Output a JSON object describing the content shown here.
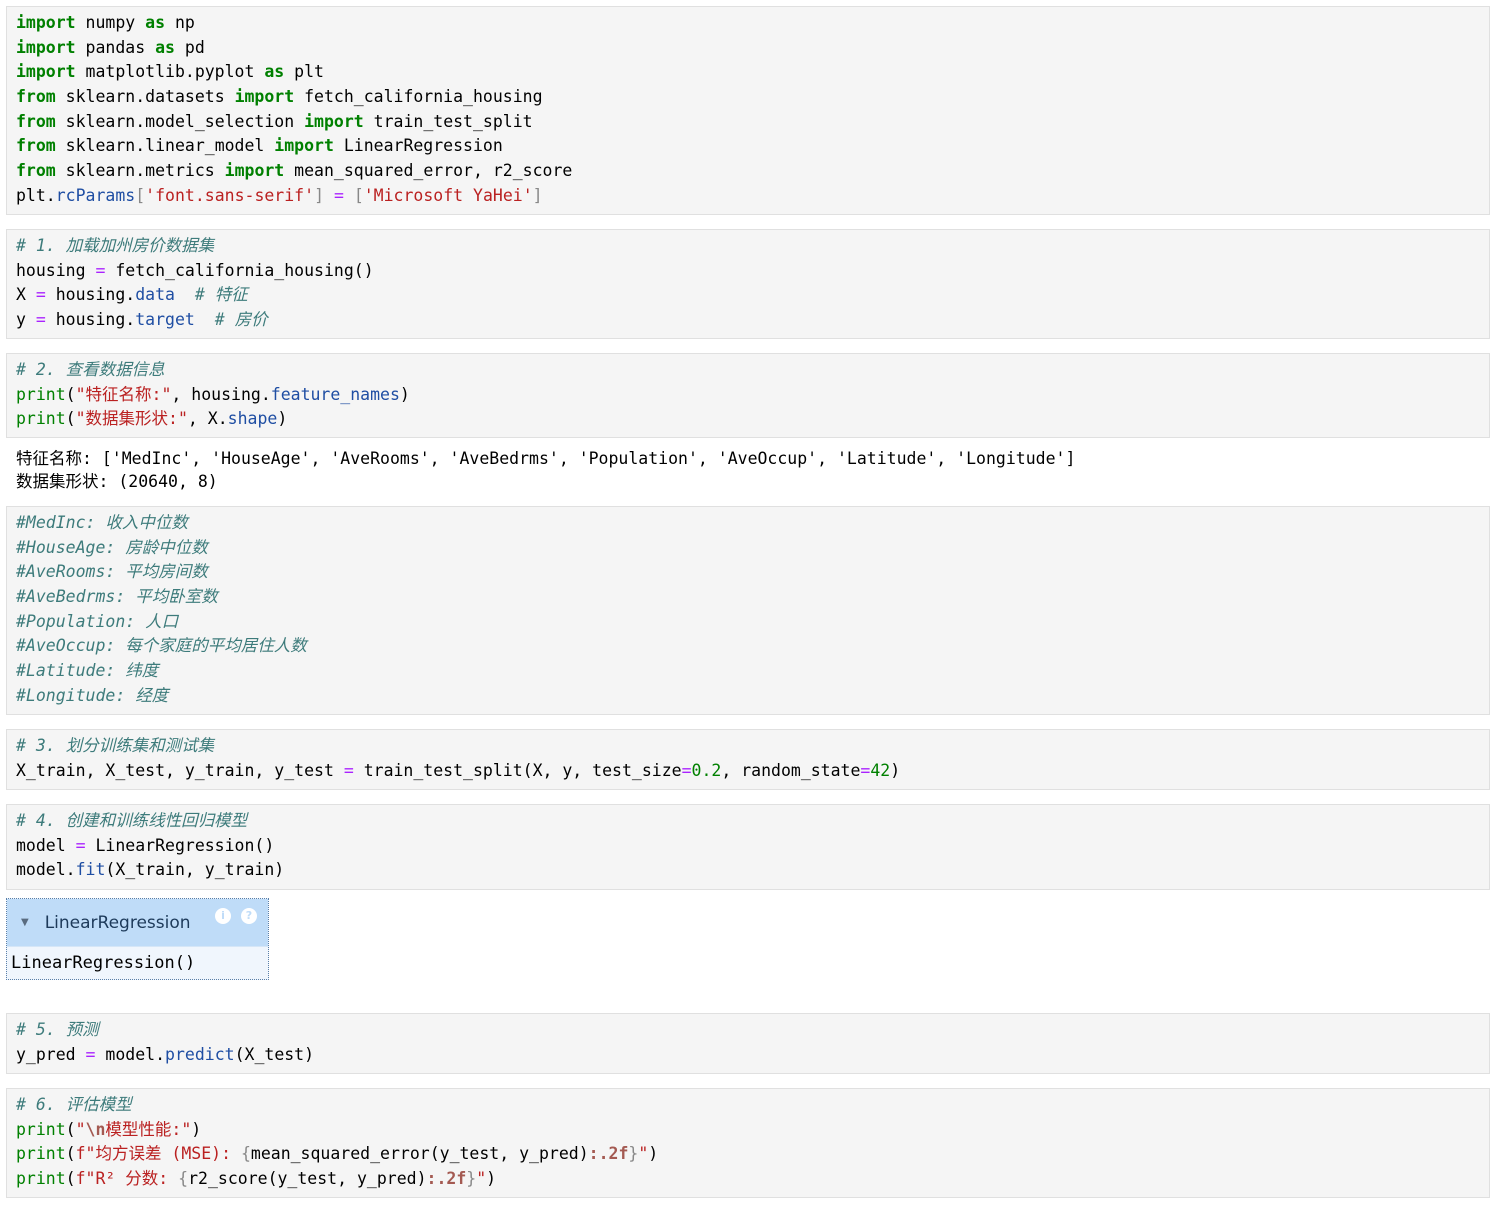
{
  "cells": [
    {
      "id": "imports",
      "lines": [
        [
          [
            "kw",
            "import"
          ],
          [
            "t",
            " numpy "
          ],
          [
            "kw",
            "as"
          ],
          [
            "t",
            " np"
          ]
        ],
        [
          [
            "kw",
            "import"
          ],
          [
            "t",
            " pandas "
          ],
          [
            "kw",
            "as"
          ],
          [
            "t",
            " pd"
          ]
        ],
        [
          [
            "kw",
            "import"
          ],
          [
            "t",
            " matplotlib.pyplot "
          ],
          [
            "kw",
            "as"
          ],
          [
            "t",
            " plt"
          ]
        ],
        [
          [
            "kw",
            "from"
          ],
          [
            "t",
            " sklearn.datasets "
          ],
          [
            "kw",
            "import"
          ],
          [
            "t",
            " fetch_california_housing"
          ]
        ],
        [
          [
            "kw",
            "from"
          ],
          [
            "t",
            " sklearn.model_selection "
          ],
          [
            "kw",
            "import"
          ],
          [
            "t",
            " train_test_split"
          ]
        ],
        [
          [
            "kw",
            "from"
          ],
          [
            "t",
            " sklearn.linear_model "
          ],
          [
            "kw",
            "import"
          ],
          [
            "t",
            " LinearRegression"
          ]
        ],
        [
          [
            "kw",
            "from"
          ],
          [
            "t",
            " sklearn.metrics "
          ],
          [
            "kw",
            "import"
          ],
          [
            "t",
            " mean_squared_error, r2_score"
          ]
        ],
        [
          [
            "t",
            "plt."
          ],
          [
            "attr",
            "rcParams"
          ],
          [
            "brk",
            "["
          ],
          [
            "str",
            "'font.sans-serif'"
          ],
          [
            "brk",
            "]"
          ],
          [
            "t",
            " "
          ],
          [
            "op",
            "="
          ],
          [
            "t",
            " "
          ],
          [
            "brk",
            "["
          ],
          [
            "str",
            "'Microsoft YaHei'"
          ],
          [
            "brk",
            "]"
          ]
        ]
      ]
    },
    {
      "id": "load-data",
      "lines": [
        [
          [
            "cm",
            "# 1. 加载加州房价数据集"
          ]
        ],
        [
          [
            "t",
            "housing "
          ],
          [
            "op",
            "="
          ],
          [
            "t",
            " fetch_california_housing()"
          ]
        ],
        [
          [
            "t",
            "X "
          ],
          [
            "op",
            "="
          ],
          [
            "t",
            " housing."
          ],
          [
            "attr",
            "data"
          ],
          [
            "t",
            "  "
          ],
          [
            "cm",
            "# 特征"
          ]
        ],
        [
          [
            "t",
            "y "
          ],
          [
            "op",
            "="
          ],
          [
            "t",
            " housing."
          ],
          [
            "attr",
            "target"
          ],
          [
            "t",
            "  "
          ],
          [
            "cm",
            "# 房价"
          ]
        ]
      ]
    },
    {
      "id": "inspect-data",
      "lines": [
        [
          [
            "cm",
            "# 2. 查看数据信息"
          ]
        ],
        [
          [
            "fn",
            "print"
          ],
          [
            "t",
            "("
          ],
          [
            "str",
            "\"特征名称:\""
          ],
          [
            "t",
            ", housing."
          ],
          [
            "attr",
            "feature_names"
          ],
          [
            "t",
            ")"
          ]
        ],
        [
          [
            "fn",
            "print"
          ],
          [
            "t",
            "("
          ],
          [
            "str",
            "\"数据集形状:\""
          ],
          [
            "t",
            ", X."
          ],
          [
            "attr",
            "shape"
          ],
          [
            "t",
            ")"
          ]
        ]
      ]
    },
    {
      "id": "feature-notes",
      "lines": [
        [
          [
            "cm",
            "#MedInc: 收入中位数"
          ]
        ],
        [
          [
            "cm",
            "#HouseAge: 房龄中位数"
          ]
        ],
        [
          [
            "cm",
            "#AveRooms: 平均房间数"
          ]
        ],
        [
          [
            "cm",
            "#AveBedrms: 平均卧室数"
          ]
        ],
        [
          [
            "cm",
            "#Population: 人口"
          ]
        ],
        [
          [
            "cm",
            "#AveOccup: 每个家庭的平均居住人数"
          ]
        ],
        [
          [
            "cm",
            "#Latitude: 纬度"
          ]
        ],
        [
          [
            "cm",
            "#Longitude: 经度"
          ]
        ]
      ]
    },
    {
      "id": "split",
      "lines": [
        [
          [
            "cm",
            "# 3. 划分训练集和测试集"
          ]
        ],
        [
          [
            "t",
            "X_train, X_test, y_train, y_test "
          ],
          [
            "op",
            "="
          ],
          [
            "t",
            " train_test_split(X, y, test_size"
          ],
          [
            "op",
            "="
          ],
          [
            "num",
            "0.2"
          ],
          [
            "t",
            ", random_state"
          ],
          [
            "op",
            "="
          ],
          [
            "num",
            "42"
          ],
          [
            "t",
            ")"
          ]
        ]
      ]
    },
    {
      "id": "train",
      "lines": [
        [
          [
            "cm",
            "# 4. 创建和训练线性回归模型"
          ]
        ],
        [
          [
            "t",
            "model "
          ],
          [
            "op",
            "="
          ],
          [
            "t",
            " LinearRegression()"
          ]
        ],
        [
          [
            "t",
            "model."
          ],
          [
            "attr",
            "fit"
          ],
          [
            "t",
            "(X_train, y_train)"
          ]
        ]
      ]
    },
    {
      "id": "predict",
      "lines": [
        [
          [
            "cm",
            "# 5. 预测"
          ]
        ],
        [
          [
            "t",
            "y_pred "
          ],
          [
            "op",
            "="
          ],
          [
            "t",
            " model."
          ],
          [
            "attr",
            "predict"
          ],
          [
            "t",
            "(X_test)"
          ]
        ]
      ]
    },
    {
      "id": "evaluate",
      "lines": [
        [
          [
            "cm",
            "# 6. 评估模型"
          ]
        ],
        [
          [
            "fn",
            "print"
          ],
          [
            "t",
            "("
          ],
          [
            "str",
            "\""
          ],
          [
            "it",
            "\\n"
          ],
          [
            "str",
            "模型性能:\""
          ],
          [
            "t",
            ")"
          ]
        ],
        [
          [
            "fn",
            "print"
          ],
          [
            "t",
            "("
          ],
          [
            "str",
            "f\"均方误差 (MSE): "
          ],
          [
            "brk",
            "{"
          ],
          [
            "t",
            "mean_squared_error(y_test, y_pred)"
          ],
          [
            "it",
            ":.2f"
          ],
          [
            "brk",
            "}"
          ],
          [
            "str",
            "\""
          ],
          [
            "t",
            ")"
          ]
        ],
        [
          [
            "fn",
            "print"
          ],
          [
            "t",
            "("
          ],
          [
            "str",
            "f\"R² 分数: "
          ],
          [
            "brk",
            "{"
          ],
          [
            "t",
            "r2_score(y_test, y_pred)"
          ],
          [
            "it",
            ":.2f"
          ],
          [
            "brk",
            "}"
          ],
          [
            "str",
            "\""
          ],
          [
            "t",
            ")"
          ]
        ]
      ]
    }
  ],
  "outputs": {
    "inspect_line1": "特征名称: ['MedInc', 'HouseAge', 'AveRooms', 'AveBedrms', 'Population', 'AveOccup', 'Latitude', 'Longitude']",
    "inspect_line2": "数据集形状: (20640, 8)"
  },
  "widget": {
    "title": "LinearRegression",
    "repr": "LinearRegression()",
    "collapse_icon": "triangle-down-icon",
    "info_icon_1": "i",
    "info_icon_2": "?"
  }
}
